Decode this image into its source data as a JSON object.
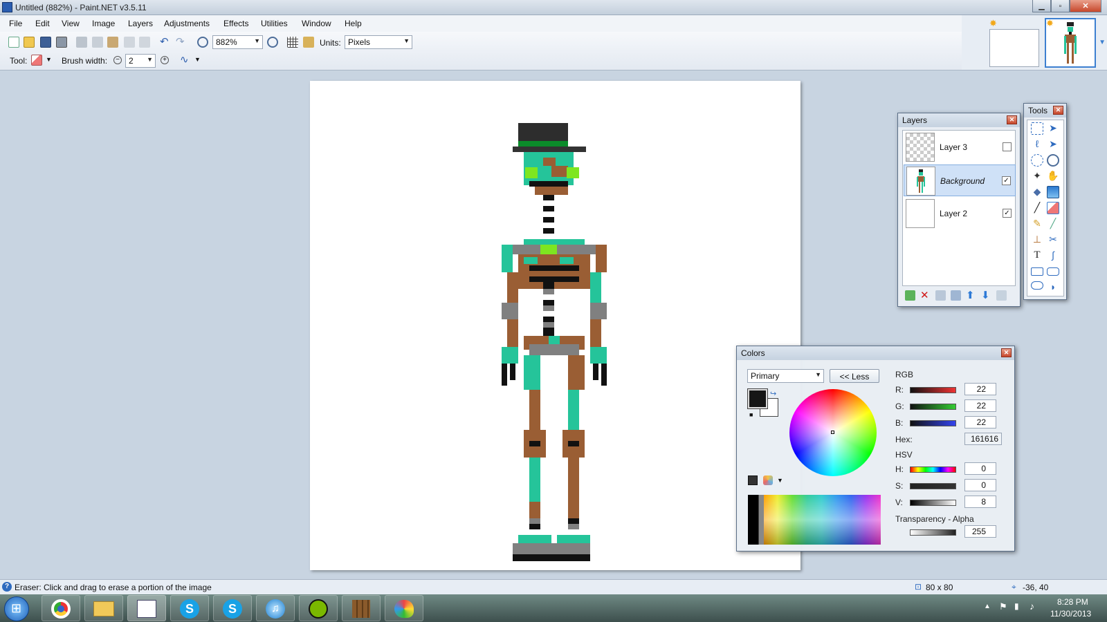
{
  "window": {
    "title": "Untitled (882%) - Paint.NET v3.5.11",
    "min_glyph": "▁",
    "max_glyph": "▫",
    "close_glyph": "✕"
  },
  "menu": [
    "File",
    "Edit",
    "View",
    "Image",
    "Layers",
    "Adjustments",
    "Effects",
    "Utilities",
    "Window",
    "Help"
  ],
  "toolbar": {
    "zoom_value": "882%",
    "units_label": "Units:",
    "units_value": "Pixels",
    "tool_label": "Tool:",
    "brush_label": "Brush width:",
    "brush_value": "2"
  },
  "layers_panel": {
    "title": "Layers",
    "layers": [
      {
        "name": "Layer 3",
        "checked": false
      },
      {
        "name": "Background",
        "checked": true
      },
      {
        "name": "Layer 2",
        "checked": true
      }
    ]
  },
  "tools_panel": {
    "title": "Tools"
  },
  "colors_panel": {
    "title": "Colors",
    "target": "Primary",
    "less_label": "<< Less",
    "rgb_label": "RGB",
    "r_label": "R:",
    "r": "22",
    "g_label": "G:",
    "g": "22",
    "b_label": "B:",
    "b": "22",
    "hex_label": "Hex:",
    "hex": "161616",
    "hsv_label": "HSV",
    "h_label": "H:",
    "h": "0",
    "s_label": "S:",
    "s": "0",
    "v_label": "V:",
    "v": "8",
    "alpha_label": "Transparency - Alpha",
    "alpha": "255"
  },
  "status": {
    "hint": "Eraser: Click and drag to erase a portion of the image",
    "size": "80 x 80",
    "cursor": "-36, 40"
  },
  "taskbar": {
    "time": "8:28 PM",
    "date": "11/30/2013"
  }
}
